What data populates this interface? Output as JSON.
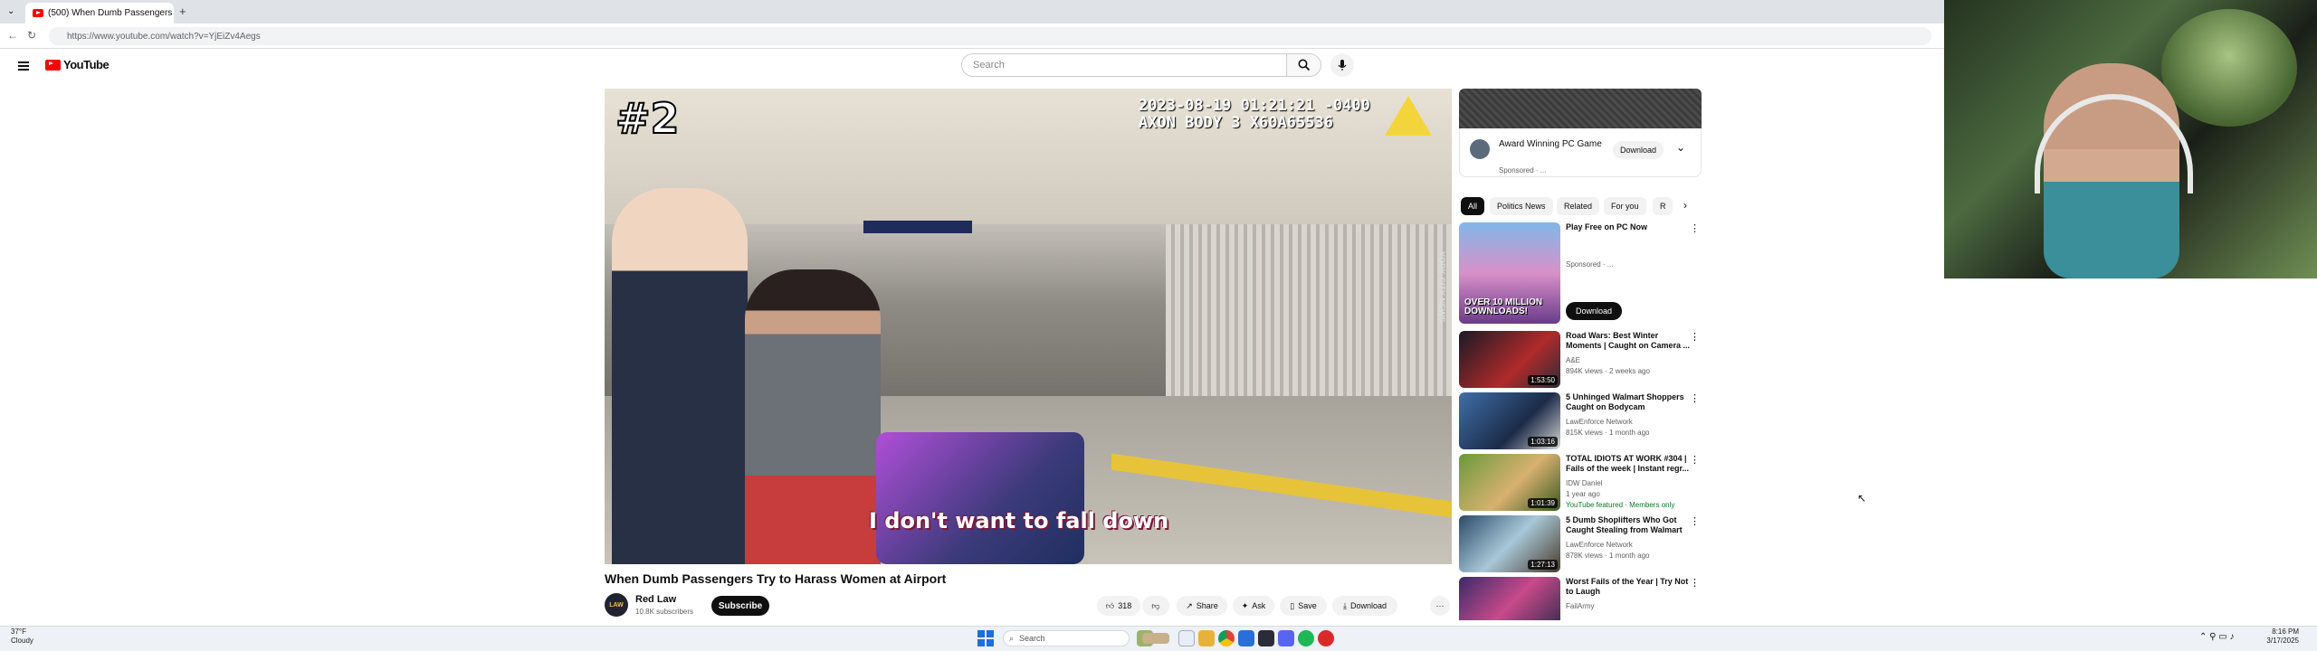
{
  "browser": {
    "tab_title": "(500) When Dumb Passengers",
    "tab_close": "×",
    "new_tab": "+",
    "url": "https://www.youtube.com/watch?v=YjEiZv4Aegs"
  },
  "masthead": {
    "logo_text": "YouTube",
    "search_placeholder": "Search"
  },
  "video": {
    "overlay_number": "#2",
    "timestamp": "2023-08-19 01:21:21 -0400\nAXON BODY 3 X60A65536",
    "caption": "I don't want to fall down",
    "side_watermark": "YORK CITY NEWS",
    "title": "When Dumb Passengers Try to Harass Women at Airport",
    "channel": "Red Law",
    "channel_avatar": "LAW",
    "subscribers": "10.8K subscribers",
    "subscribe_label": "Subscribe",
    "like_count": "318",
    "share_label": "Share",
    "ask_label": "Ask",
    "save_label": "Save",
    "download_label": "Download",
    "more_label": "···"
  },
  "ad": {
    "title": "Award Winning PC Game",
    "sponsored": "Sponsored · ...",
    "download": "Download"
  },
  "chips": [
    "All",
    "Politics News",
    "Related",
    "For you",
    "R"
  ],
  "recommendations": [
    {
      "title": "Play Free on PC Now",
      "channel": "Sponsored · ...",
      "meta": "",
      "duration": "",
      "action": "Download",
      "badge": "OVER 10 MILLION DOWNLOADS!"
    },
    {
      "title": "Road Wars: Best Winter Moments | Caught on Camera ...",
      "channel": "A&E",
      "meta": "894K views · 2 weeks ago",
      "duration": "1:53:50",
      "action": "",
      "badge": ""
    },
    {
      "title": "5 Unhinged Walmart Shoppers Caught on Bodycam",
      "channel": "LawEnforce Network",
      "meta": "815K views · 1 month ago",
      "duration": "1:03:16",
      "action": "",
      "badge": ""
    },
    {
      "title": "TOTAL IDIOTS AT WORK #304 | Fails of the week | Instant regr...",
      "channel": "IDW Daniel",
      "meta": "1 year ago",
      "duration": "1:01:39",
      "action": "",
      "badge": "YouTube featured · Members only"
    },
    {
      "title": "5 Dumb Shoplifters Who Got Caught Stealing from Walmart",
      "channel": "LawEnforce Network",
      "meta": "878K views · 1 month ago",
      "duration": "1:27:13",
      "action": "",
      "badge": ""
    },
    {
      "title": "Worst Fails of the Year | Try Not to Laugh",
      "channel": "FailArmy",
      "meta": "",
      "duration": "",
      "action": "",
      "badge": ""
    }
  ],
  "taskbar": {
    "weather_temp": "37°F",
    "weather_desc": "Cloudy",
    "search": "Search",
    "time": "8:16 PM",
    "date": "3/17/2025"
  },
  "colors": {
    "yt_red": "#ff0000",
    "subscribe_bg": "#0f0f0f",
    "chip_active": "#0f0f0f"
  }
}
